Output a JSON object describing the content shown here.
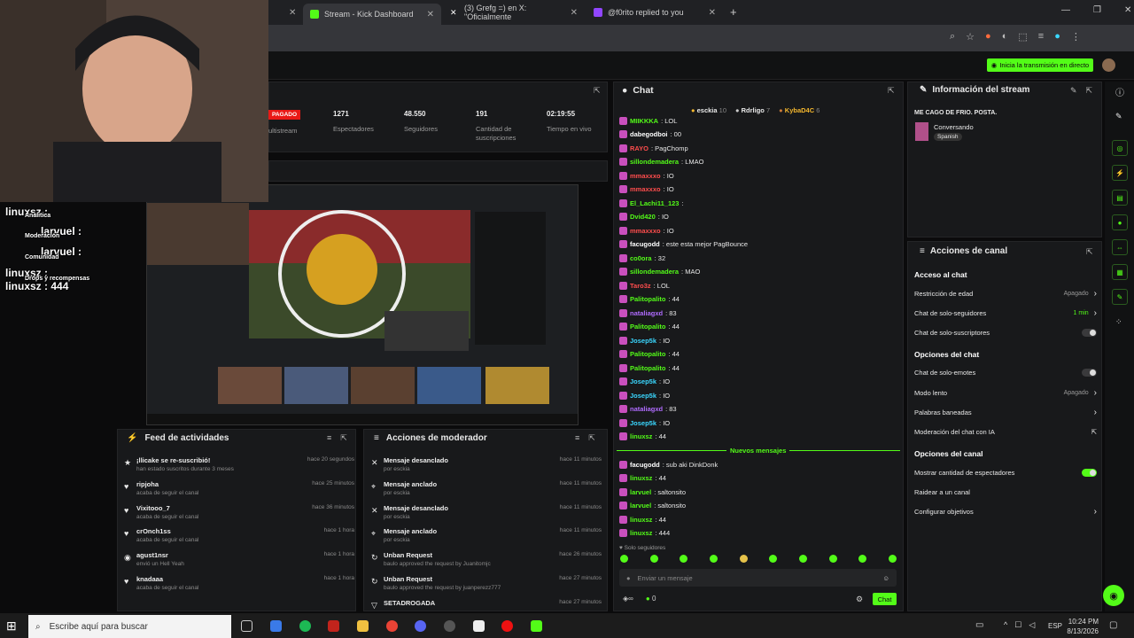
{
  "browser": {
    "tabs": [
      {
        "label": "Stream - Kick Dashboard"
      },
      {
        "label": "(3) Grefg =) en X: \"Oficialmente"
      },
      {
        "label": "@f0rito replied to you"
      }
    ],
    "new_tab": "+"
  },
  "header": {
    "go_live": "Inicia la transmisión en directo"
  },
  "stats": {
    "live_badge": "PAGADO",
    "multistream": "ultistream",
    "viewers_value": "1271",
    "viewers_label": "Espectadores",
    "followers_value": "48.550",
    "followers_label": "Seguidores",
    "subs_value": "191",
    "subs_label": "Cantidad de suscripciones",
    "time_value": "02:19:55",
    "time_label": "Tiempo en vivo"
  },
  "overlay": {
    "lines": [
      "linuxsz :",
      "Analitica",
      "larvuel :",
      "Moderación",
      "larvuel :",
      "Comunidad",
      "linuxsz :",
      "Drops y recompensas",
      "linuxsz : 444"
    ]
  },
  "chat": {
    "title": "Chat",
    "top_users": [
      {
        "name": "esckia",
        "n": "10"
      },
      {
        "name": "Rdrligo",
        "n": "7"
      },
      {
        "name": "KybaD4C",
        "n": "6"
      }
    ],
    "messages": [
      {
        "user": "MIIKKKA",
        "text": ": LOL",
        "color": "#53fc18"
      },
      {
        "user": "dabegodboi",
        "text": ": 00",
        "color": "#ffffff"
      },
      {
        "user": "RAYO",
        "text": ": PagChomp",
        "color": "#ff4d4d"
      },
      {
        "user": "sillondemadera",
        "text": ": LMAO",
        "color": "#53fc18"
      },
      {
        "user": "mmaxxxo",
        "text": ": IO",
        "color": "#ff4d4d"
      },
      {
        "user": "mmaxxxo",
        "text": ": IO",
        "color": "#ff4d4d"
      },
      {
        "user": "El_Lachi11_123",
        "text": ":",
        "color": "#53fc18"
      },
      {
        "user": "Dvid420",
        "text": ": IO",
        "color": "#53fc18"
      },
      {
        "user": "mmaxxxo",
        "text": ": IO",
        "color": "#ff4d4d"
      },
      {
        "user": "facugodd",
        "text": ": este esta mejor PagBounce",
        "color": "#ffffff"
      },
      {
        "user": "co0ora",
        "text": ": 32",
        "color": "#53fc18"
      },
      {
        "user": "sillondemadera",
        "text": ": MAO",
        "color": "#53fc18"
      },
      {
        "user": "Taro3z",
        "text": ": LOL",
        "color": "#ff4d4d"
      },
      {
        "user": "Palitopalito",
        "text": ": 44",
        "color": "#53fc18"
      },
      {
        "user": "nataliagxd",
        "text": ": 83",
        "color": "#b06cff"
      },
      {
        "user": "Palitopalito",
        "text": ": 44",
        "color": "#53fc18"
      },
      {
        "user": "Josep5k",
        "text": ": IO",
        "color": "#3ad7ff"
      },
      {
        "user": "Palitopalito",
        "text": ": 44",
        "color": "#53fc18"
      },
      {
        "user": "Palitopalito",
        "text": ": 44",
        "color": "#53fc18"
      },
      {
        "user": "Josep5k",
        "text": ": IO",
        "color": "#3ad7ff"
      },
      {
        "user": "Josep5k",
        "text": ": IO",
        "color": "#3ad7ff"
      },
      {
        "user": "nataliagxd",
        "text": ": 83",
        "color": "#b06cff"
      },
      {
        "user": "Josep5k",
        "text": ": IO",
        "color": "#3ad7ff"
      },
      {
        "user": "linuxsz",
        "text": ": 44",
        "color": "#53fc18"
      }
    ],
    "new_label": "Nuevos mensajes",
    "new_messages": [
      {
        "user": "facugodd",
        "text": ": sub aki DinkDonk",
        "color": "#ffffff"
      },
      {
        "user": "linuxsz",
        "text": ": 44",
        "color": "#53fc18"
      },
      {
        "user": "larvuel",
        "text": ": saltonsito",
        "color": "#53fc18"
      },
      {
        "user": "larvuel",
        "text": ": saltonsito",
        "color": "#53fc18"
      },
      {
        "user": "linuxsz",
        "text": ": 44",
        "color": "#53fc18"
      },
      {
        "user": "linuxsz",
        "text": ": 444",
        "color": "#53fc18"
      }
    ],
    "followers_only": "Solo seguidores",
    "input_placeholder": "Enviar un mensaje",
    "count": "0",
    "send": "Chat"
  },
  "info": {
    "title": "Información del stream",
    "stream_title": "ME CAGO DE FRIO. POSTA.",
    "category": "Conversando",
    "language": "Spanish"
  },
  "actions": {
    "title": "Acciones de canal",
    "sections": [
      {
        "heading": "Acceso al chat",
        "rows": [
          {
            "label": "Restricción de edad",
            "value": "Apagado",
            "kind": "arrow"
          },
          {
            "label": "Chat de solo-seguidores",
            "value": "1 min",
            "kind": "arrow"
          },
          {
            "label": "Chat de solo-suscriptores",
            "value": "",
            "kind": "toggle"
          }
        ]
      },
      {
        "heading": "Opciones del chat",
        "rows": [
          {
            "label": "Chat de solo-emotes",
            "value": "",
            "kind": "toggle"
          },
          {
            "label": "Modo lento",
            "value": "Apagado",
            "kind": "arrow"
          },
          {
            "label": "Palabras baneadas",
            "value": "",
            "kind": "arrow"
          },
          {
            "label": "Moderación del chat con IA",
            "value": "",
            "kind": "ext"
          }
        ]
      },
      {
        "heading": "Opciones del canal",
        "rows": [
          {
            "label": "Mostrar cantidad de espectadores",
            "value": "",
            "kind": "toggle-on"
          },
          {
            "label": "Raidear a un canal",
            "value": "",
            "kind": "none"
          },
          {
            "label": "Configurar objetivos",
            "value": "",
            "kind": "arrow"
          }
        ]
      }
    ]
  },
  "feed": {
    "title": "Feed de actividades",
    "items": [
      {
        "title": "¡llicake se re-suscribió!",
        "sub": "han estado suscritos durante 3 meses",
        "time": "hace 20 segundos"
      },
      {
        "title": "ripjoha",
        "sub": "acaba de seguir el canal",
        "time": "hace 25 minutos"
      },
      {
        "title": "Vixitooo_7",
        "sub": "acaba de seguir el canal",
        "time": "hace 36 minutos"
      },
      {
        "title": "crOnch1ss",
        "sub": "acaba de seguir el canal",
        "time": "hace 1 hora"
      },
      {
        "title": "agust1nsr",
        "sub": "envió un Hell Yeah",
        "time": "hace 1 hora"
      },
      {
        "title": "knadaaa",
        "sub": "acaba de seguir el canal",
        "time": "hace 1 hora"
      }
    ]
  },
  "mod": {
    "title": "Acciones de moderador",
    "items": [
      {
        "title": "Mensaje desanclado",
        "sub": "por esckia",
        "time": "hace 11 minutos"
      },
      {
        "title": "Mensaje anclado",
        "sub": "por esckia",
        "time": "hace 11 minutos"
      },
      {
        "title": "Mensaje desanclado",
        "sub": "por esckia",
        "time": "hace 11 minutos"
      },
      {
        "title": "Mensaje anclado",
        "sub": "por esckia",
        "time": "hace 11 minutos"
      },
      {
        "title": "Unban Request",
        "sub": "baulo approved the request by Juanitomjc",
        "time": "hace 26 minutos"
      },
      {
        "title": "Unban Request",
        "sub": "baulo approved the request by juanperezz777",
        "time": "hace 27 minutos"
      },
      {
        "title": "SETADROGADA",
        "sub": "",
        "time": "hace 27 minutos"
      }
    ]
  },
  "taskbar": {
    "search": "Escribe aquí para buscar",
    "time": "10:24 PM",
    "date": "8/13/2026",
    "lang": "ESP"
  }
}
